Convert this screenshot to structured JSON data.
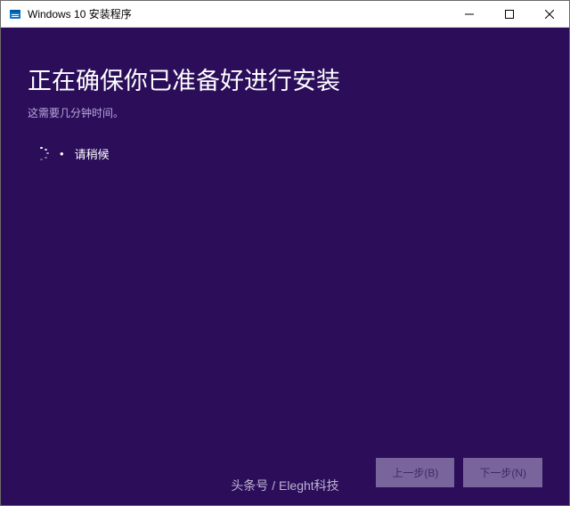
{
  "titlebar": {
    "title": "Windows 10 安装程序"
  },
  "content": {
    "heading": "正在确保你已准备好进行安装",
    "subtext": "这需要几分钟时间。",
    "loading_label": "请稍候"
  },
  "buttons": {
    "back": "上一步(B)",
    "next": "下一步(N)"
  },
  "watermark": "头条号 / Eleght科技"
}
